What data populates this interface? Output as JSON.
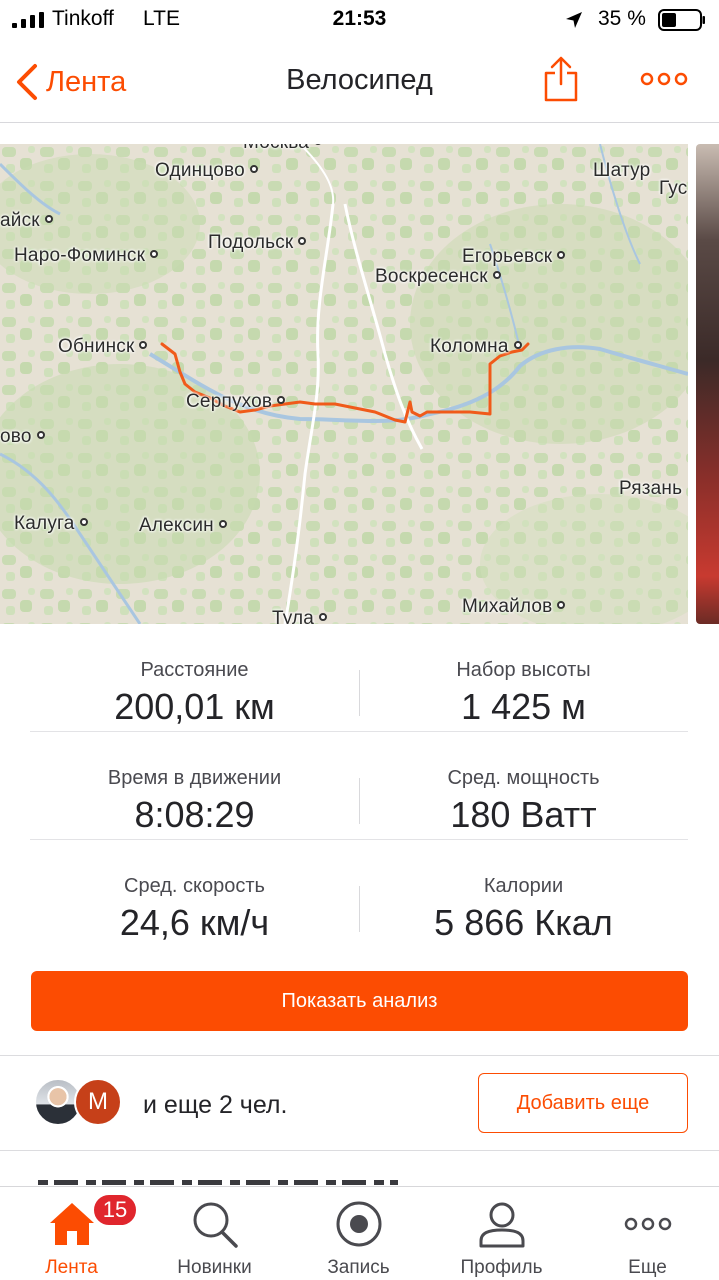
{
  "status_bar": {
    "carrier": "Tinkoff",
    "network": "LTE",
    "time": "21:53",
    "battery_percent": "35 %"
  },
  "nav": {
    "back_label": "Лента",
    "title": "Велосипед",
    "accent_color": "#fc4c02"
  },
  "map": {
    "route_color": "#f05a1a",
    "labels": {
      "moskva": "Москва",
      "odintsovo": "Одинцово",
      "shatura": "Шатур",
      "gus": "Гус",
      "aisk": "айск",
      "podolsk": "Подольск",
      "naro_fominsk": "Наро-Фоминск",
      "egorievsk": "Егорьевск",
      "voskresensk": "Воскресенск",
      "obninsk": "Обнинск",
      "kolomna": "Коломна",
      "serpukhov": "Серпухов",
      "ovo": "ово",
      "ryazan": "Рязань",
      "kaluga": "Калуга",
      "aleksin": "Алексин",
      "mikhailov": "Михайлов",
      "tula": "Тула"
    }
  },
  "stats": [
    {
      "label": "Расстояние",
      "value": "200,01 км"
    },
    {
      "label": "Набор высоты",
      "value": "1 425 м"
    },
    {
      "label": "Время в движении",
      "value": "8:08:29"
    },
    {
      "label": "Сред. мощность",
      "value": "180 Ватт"
    },
    {
      "label": "Сред. скорость",
      "value": "24,6 км/ч"
    },
    {
      "label": "Калории",
      "value": "5 866 Ккал"
    }
  ],
  "analysis_button": "Показать анализ",
  "participants": {
    "avatar_letter": "M",
    "text": "и еще 2 чел.",
    "add_button": "Добавить еще"
  },
  "tabs": [
    {
      "label": "Лента",
      "icon": "home-icon",
      "active": true,
      "badge": "15"
    },
    {
      "label": "Новинки",
      "icon": "search-icon"
    },
    {
      "label": "Запись",
      "icon": "record-icon"
    },
    {
      "label": "Профиль",
      "icon": "profile-icon"
    },
    {
      "label": "Еще",
      "icon": "more-icon"
    }
  ]
}
